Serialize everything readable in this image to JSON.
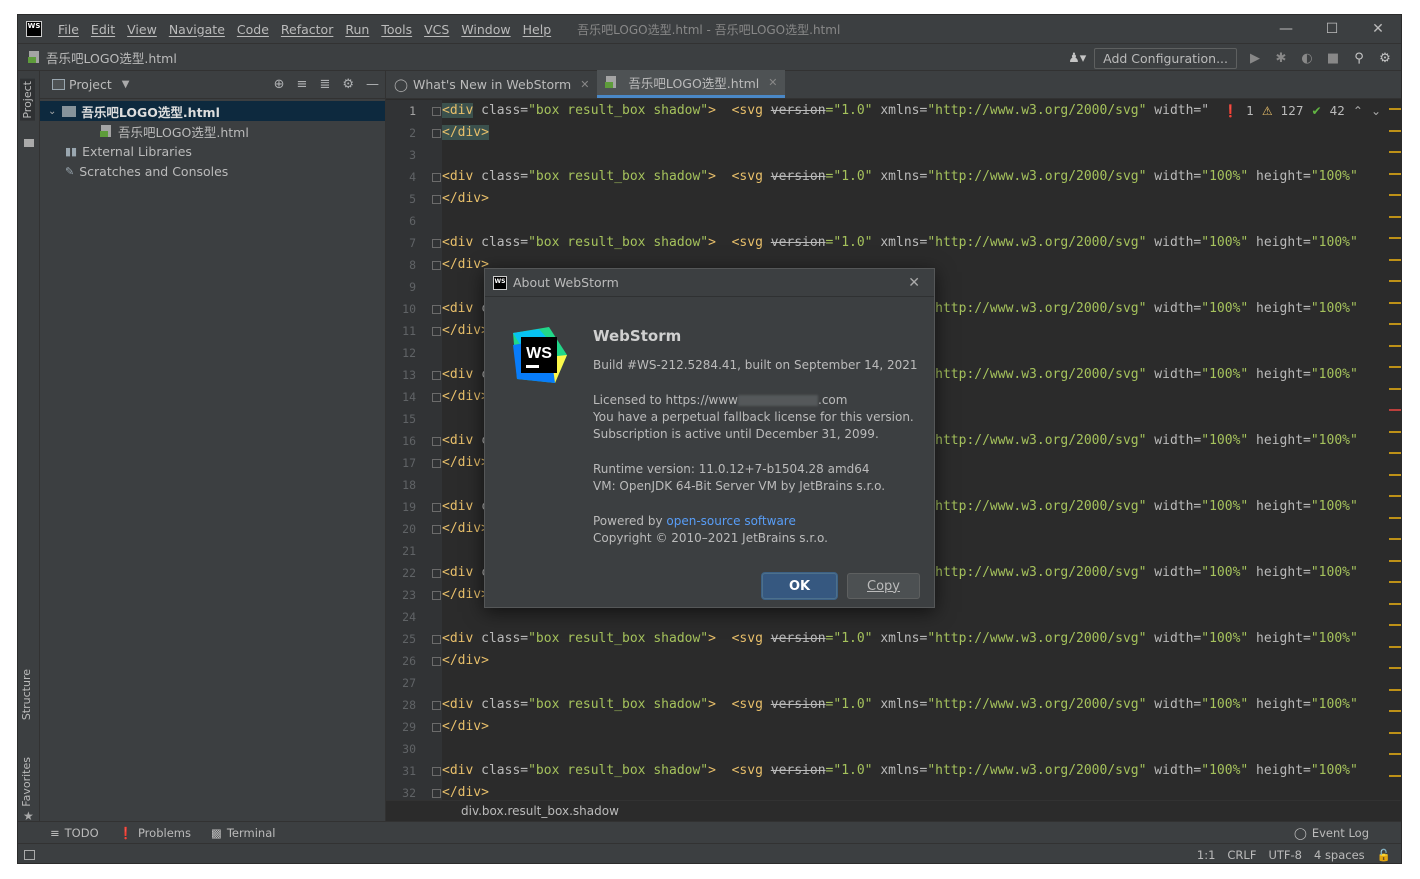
{
  "app": {
    "logo_text": "WS",
    "menu": [
      "File",
      "Edit",
      "View",
      "Navigate",
      "Code",
      "Refactor",
      "Run",
      "Tools",
      "VCS",
      "Window",
      "Help"
    ],
    "window_title": "吾乐吧LOGO选型.html - 吾乐吧LOGO选型.html"
  },
  "navbar": {
    "file": "吾乐吧LOGO选型.html",
    "add_configuration": "Add Configuration..."
  },
  "side_tabs": {
    "project": "Project",
    "structure": "Structure",
    "favorites": "Favorites"
  },
  "project": {
    "header": "Project",
    "tree": [
      {
        "label": "吾乐吧LOGO选型.html",
        "level": 0,
        "selected": true,
        "type": "folder"
      },
      {
        "label": "吾乐吧LOGO选型.html",
        "level": 1,
        "selected": false,
        "type": "html"
      },
      {
        "label": "External Libraries",
        "level": 0,
        "selected": false,
        "type": "lib"
      },
      {
        "label": "Scratches and Consoles",
        "level": 0,
        "selected": false,
        "type": "scratch"
      }
    ]
  },
  "editor": {
    "tabs": [
      {
        "label": "What's New in WebStorm",
        "active": false
      },
      {
        "label": "吾乐吧LOGO选型.html",
        "active": true
      }
    ],
    "inspections": {
      "errors": "1",
      "warnings": "127",
      "weak": "42"
    },
    "line_numbers": [
      "1",
      "2",
      "3",
      "4",
      "5",
      "6",
      "7",
      "8",
      "9",
      "10",
      "11",
      "12",
      "13",
      "14",
      "15",
      "16",
      "17",
      "18",
      "19",
      "20",
      "21",
      "22",
      "23",
      "24",
      "25",
      "26",
      "27",
      "28",
      "29",
      "30",
      "31",
      "32"
    ],
    "code": {
      "open_tag": "<div",
      "class_attr": " class=",
      "class_val": "\"box result_box shadow\"",
      "close_open": ">",
      "svg_tag": "  <svg ",
      "version_attr": "version",
      "version_val": "=\"1.0\"",
      "xmlns_attr": " xmlns=",
      "xmlns_val": "\"http://www.w3.org/2000/svg\"",
      "width_attr": " width=",
      "width_val": "\"100%\"",
      "height_attr": " height=",
      "height_val": "\"100%\"",
      "close_tag": "</div>",
      "first_line_width": " width=\""
    },
    "breadcrumb": "div.box.result_box.shadow"
  },
  "bottom_tools": [
    "TODO",
    "Problems",
    "Terminal"
  ],
  "event_log": "Event Log",
  "status": {
    "position": "1:1",
    "line_sep": "CRLF",
    "encoding": "UTF-8",
    "indent": "4 spaces"
  },
  "dialog": {
    "title": "About WebStorm",
    "product": "WebStorm",
    "build": "Build #WS-212.5284.41, built on September 14, 2021",
    "licensed_prefix": "Licensed to https://www",
    "licensed_suffix": ".com",
    "fallback": "You have a perpetual fallback license for this version.",
    "subscription": "Subscription is active until December 31, 2099.",
    "runtime": "Runtime version: 11.0.12+7-b1504.28 amd64",
    "vm": "VM: OpenJDK 64-Bit Server VM by JetBrains s.r.o.",
    "powered_prefix": "Powered by ",
    "powered_link": "open-source software",
    "copyright": "Copyright © 2010–2021 JetBrains s.r.o.",
    "ok": "OK",
    "copy": "Copy"
  },
  "colors": {
    "accent": "#4a88c7",
    "tag": "#e8bf6a",
    "string": "#a5c25c",
    "error": "#e05555",
    "warning": "#be9117",
    "ok_button": "#365880",
    "link": "#589df6"
  }
}
